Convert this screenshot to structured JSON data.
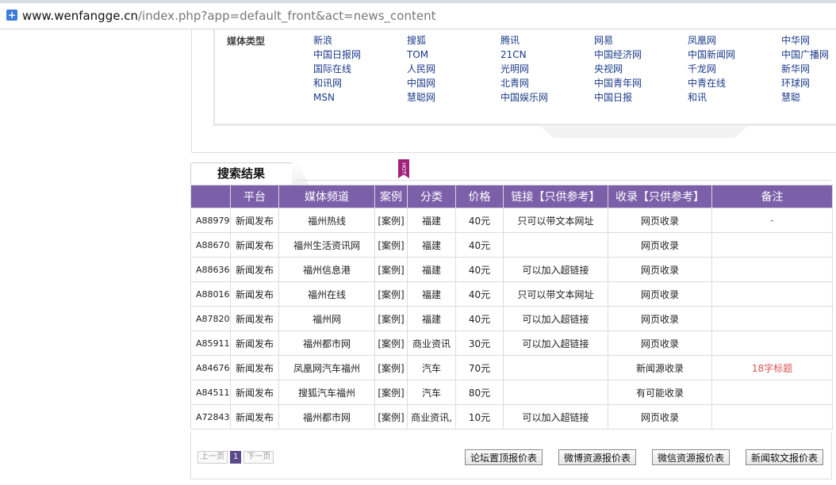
{
  "browser": {
    "url_host": "www.wenfangge.cn",
    "url_path": "/index.php?app=default_front&act=news_content",
    "lock_icon": "plus-shield-icon"
  },
  "media_filter": {
    "label": "媒体类型",
    "items": [
      "新浪",
      "搜狐",
      "腾讯",
      "网易",
      "凤凰网",
      "中华网",
      "中国日报网",
      "TOM",
      "21CN",
      "中国经济网",
      "中国新闻网",
      "中国广播网",
      "国际在线",
      "人民网",
      "光明网",
      "央视网",
      "千龙网",
      "新华网",
      "和讯网",
      "中国网",
      "北青网",
      "中国青年网",
      "中青在线",
      "环球网",
      "MSN",
      "慧聪网",
      "中国娱乐网",
      "中国日报",
      "和讯",
      "慧聪"
    ]
  },
  "results": {
    "title": "搜索结果",
    "hot_badge": "HOT",
    "columns": [
      "",
      "平台",
      "媒体频道",
      "案例",
      "分类",
      "价格",
      "链接【只供参考】",
      "收录【只供参考】",
      "备注"
    ],
    "rows": [
      {
        "id": "A88979",
        "platform": "新闻发布",
        "channel": "福州热线",
        "case": "[案例]",
        "category": "福建",
        "price": "40元",
        "link": "只可以带文本网址",
        "index": "网页收录",
        "note": "-"
      },
      {
        "id": "A88670",
        "platform": "新闻发布",
        "channel": "福州生活资讯网",
        "case": "[案例]",
        "category": "福建",
        "price": "40元",
        "link": "",
        "index": "网页收录",
        "note": ""
      },
      {
        "id": "A88636",
        "platform": "新闻发布",
        "channel": "福州信息港",
        "case": "[案例]",
        "category": "福建",
        "price": "40元",
        "link": "可以加入超链接",
        "index": "网页收录",
        "note": ""
      },
      {
        "id": "A88016",
        "platform": "新闻发布",
        "channel": "福州在线",
        "case": "[案例]",
        "category": "福建",
        "price": "40元",
        "link": "只可以带文本网址",
        "index": "网页收录",
        "note": ""
      },
      {
        "id": "A87820",
        "platform": "新闻发布",
        "channel": "福州网",
        "case": "[案例]",
        "category": "福建",
        "price": "40元",
        "link": "可以加入超链接",
        "index": "网页收录",
        "note": ""
      },
      {
        "id": "A85911",
        "platform": "新闻发布",
        "channel": "福州都市网",
        "case": "[案例]",
        "category": "商业资讯",
        "price": "30元",
        "link": "可以加入超链接",
        "index": "网页收录",
        "note": ""
      },
      {
        "id": "A84676",
        "platform": "新闻发布",
        "channel": "凤凰网汽车福州",
        "case": "[案例]",
        "category": "汽车",
        "price": "70元",
        "link": "",
        "index": "新闻源收录",
        "note": "18字标题"
      },
      {
        "id": "A84511",
        "platform": "新闻发布",
        "channel": "搜狐汽车福州",
        "case": "[案例]",
        "category": "汽车",
        "price": "80元",
        "link": "",
        "index": "有可能收录",
        "note": ""
      },
      {
        "id": "A72843",
        "platform": "新闻发布",
        "channel": "福州都市网",
        "case": "[案例]",
        "category": "商业资讯,",
        "price": "10元",
        "link": "可以加入超链接",
        "index": "网页收录",
        "note": ""
      }
    ]
  },
  "pager": {
    "prev": "上一页",
    "current": "1",
    "next": "下一页"
  },
  "price_buttons": [
    "论坛置顶报价表",
    "微博资源报价表",
    "微信资源报价表",
    "新闻软文报价表"
  ]
}
